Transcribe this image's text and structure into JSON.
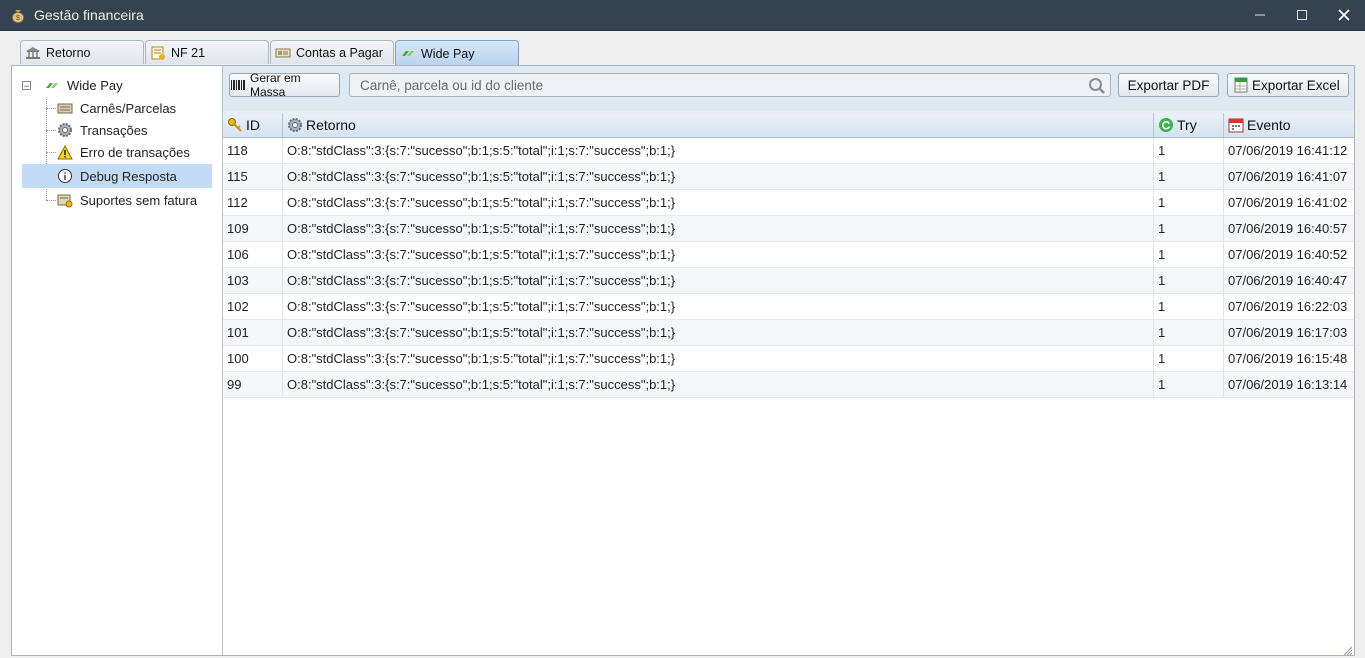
{
  "window": {
    "title": "Gestão financeira",
    "minimize": "—",
    "maximize": "☐",
    "close": "✕"
  },
  "tabs": [
    {
      "label": "Retorno",
      "icon": "bank-icon"
    },
    {
      "label": "NF 21",
      "icon": "invoice-icon"
    },
    {
      "label": "Contas a Pagar",
      "icon": "bill-icon"
    },
    {
      "label": "Wide Pay",
      "icon": "widepay-icon",
      "active": true
    }
  ],
  "tree": {
    "root": {
      "label": "Wide Pay",
      "expander": "−"
    },
    "items": [
      {
        "label": "Carnês/Parcelas",
        "icon": "booklet-icon"
      },
      {
        "label": "Transações",
        "icon": "gear-icon"
      },
      {
        "label": "Erro de transações",
        "icon": "warning-icon"
      },
      {
        "label": "Debug Resposta",
        "icon": "info-icon",
        "selected": true
      },
      {
        "label": "Suportes sem fatura",
        "icon": "ticket-icon"
      }
    ]
  },
  "toolbar": {
    "generate_label": "Gerar em Massa",
    "search_placeholder": "Carnê, parcela ou id do cliente",
    "export_pdf_label": "Exportar PDF",
    "export_excel_label": "Exportar Excel"
  },
  "table": {
    "columns": [
      {
        "label": "ID",
        "icon": "key-icon"
      },
      {
        "label": "Retorno",
        "icon": "gear-icon"
      },
      {
        "label": "Try",
        "icon": "refresh-icon"
      },
      {
        "label": "Evento",
        "icon": "calendar-icon"
      }
    ],
    "rows": [
      {
        "id": "118",
        "retorno": "O:8:\"stdClass\":3:{s:7:\"sucesso\";b:1;s:5:\"total\";i:1;s:7:\"success\";b:1;}",
        "try": "1",
        "evento": "07/06/2019 16:41:12"
      },
      {
        "id": "115",
        "retorno": "O:8:\"stdClass\":3:{s:7:\"sucesso\";b:1;s:5:\"total\";i:1;s:7:\"success\";b:1;}",
        "try": "1",
        "evento": "07/06/2019 16:41:07"
      },
      {
        "id": "112",
        "retorno": "O:8:\"stdClass\":3:{s:7:\"sucesso\";b:1;s:5:\"total\";i:1;s:7:\"success\";b:1;}",
        "try": "1",
        "evento": "07/06/2019 16:41:02"
      },
      {
        "id": "109",
        "retorno": "O:8:\"stdClass\":3:{s:7:\"sucesso\";b:1;s:5:\"total\";i:1;s:7:\"success\";b:1;}",
        "try": "1",
        "evento": "07/06/2019 16:40:57"
      },
      {
        "id": "106",
        "retorno": "O:8:\"stdClass\":3:{s:7:\"sucesso\";b:1;s:5:\"total\";i:1;s:7:\"success\";b:1;}",
        "try": "1",
        "evento": "07/06/2019 16:40:52"
      },
      {
        "id": "103",
        "retorno": "O:8:\"stdClass\":3:{s:7:\"sucesso\";b:1;s:5:\"total\";i:1;s:7:\"success\";b:1;}",
        "try": "1",
        "evento": "07/06/2019 16:40:47"
      },
      {
        "id": "102",
        "retorno": "O:8:\"stdClass\":3:{s:7:\"sucesso\";b:1;s:5:\"total\";i:1;s:7:\"success\";b:1;}",
        "try": "1",
        "evento": "07/06/2019 16:22:03"
      },
      {
        "id": "101",
        "retorno": "O:8:\"stdClass\":3:{s:7:\"sucesso\";b:1;s:5:\"total\";i:1;s:7:\"success\";b:1;}",
        "try": "1",
        "evento": "07/06/2019 16:17:03"
      },
      {
        "id": "100",
        "retorno": "O:8:\"stdClass\":3:{s:7:\"sucesso\";b:1;s:5:\"total\";i:1;s:7:\"success\";b:1;}",
        "try": "1",
        "evento": "07/06/2019 16:15:48"
      },
      {
        "id": "99",
        "retorno": "O:8:\"stdClass\":3:{s:7:\"sucesso\";b:1;s:5:\"total\";i:1;s:7:\"success\";b:1;}",
        "try": "1",
        "evento": "07/06/2019 16:13:14"
      }
    ]
  },
  "colors": {
    "titlebar": "#354350",
    "selection": "#c3daf5",
    "header": "#d5e2ef"
  }
}
